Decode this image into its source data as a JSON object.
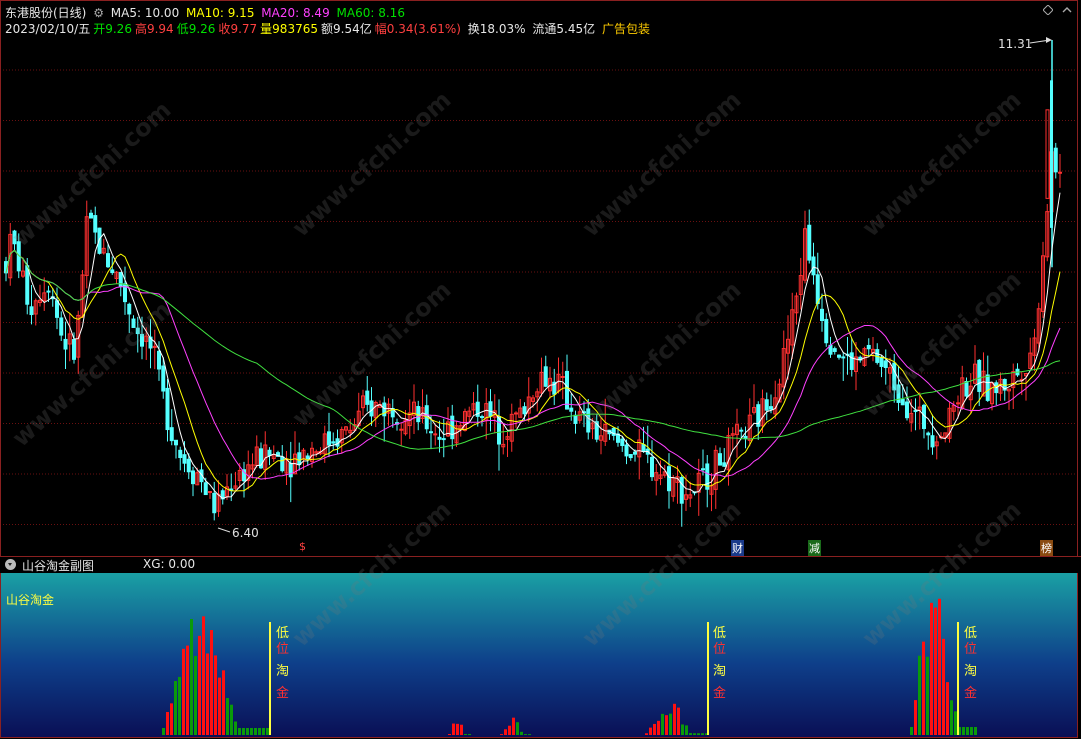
{
  "header": {
    "stock_name": "东港股份(日线)",
    "ma5": "MA5: 10.00",
    "ma10": "MA10: 9.15",
    "ma20": "MA20: 8.49",
    "ma60": "MA60: 8.16",
    "date": "2023/02/10/五",
    "open_label": "开",
    "open": "9.26",
    "high_label": "高",
    "high": "9.94",
    "low_label": "低",
    "low": "9.26",
    "close_label": "收",
    "close": "9.77",
    "volume_label": "量",
    "volume": "983765",
    "amount_label": "额",
    "amount": "9.54亿",
    "change_label": "幅",
    "change": "0.34(3.61%)",
    "turnover": "换18.03%",
    "float_cap": "流通5.45亿",
    "concept": "广告包装"
  },
  "price_marks": {
    "high": "11.31",
    "low": "6.40"
  },
  "events": {
    "e1": "$",
    "e2": "财",
    "e3": "减",
    "e4": "榜"
  },
  "sub_panel": {
    "title": "山谷淘金副图",
    "xg": "XG: 0.00",
    "indicator_label": "山谷淘金",
    "signal_chars": [
      "低",
      "位",
      "淘",
      "金"
    ]
  },
  "watermark": "www.cfchi.com",
  "colors": {
    "up": "#ff3030",
    "down": "#54ffff",
    "ma5": "#ffffff",
    "ma10": "#ffff00",
    "ma20": "#ff40ff",
    "ma60": "#40e040",
    "grid": "#6a1010",
    "sub_bg_top": "#1a9aa0",
    "sub_bg_bottom": "#0a1450"
  }
}
